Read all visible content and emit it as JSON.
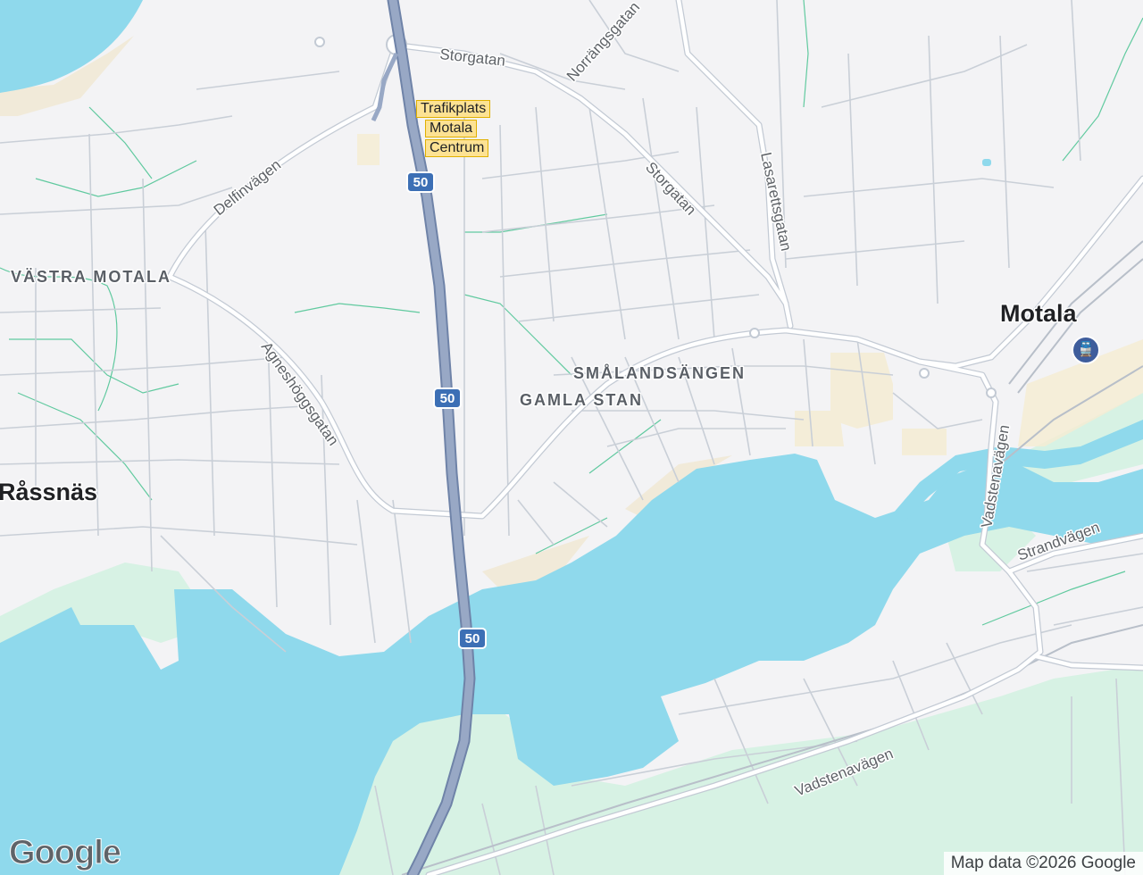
{
  "map": {
    "junction_label_lines": [
      "Trafikplats",
      "Motala",
      "Centrum"
    ],
    "route_shields": [
      "50",
      "50",
      "50"
    ],
    "streets": {
      "storgatan_1": "Storgatan",
      "storgatan_2": "Storgatan",
      "norrangsgatan": "Norrängsgatan",
      "lasarettsgatan": "Lasarettsgatan",
      "delfinvagen": "Delfinvägen",
      "agneshoggsgatan": "Agneshöggsgatan",
      "vadstenavagen_1": "Vadstenavägen",
      "vadstenavagen_2": "Vadstenavägen",
      "strandvagen": "Strandvägen"
    },
    "districts": {
      "vastra_motala": "VÄSTRA MOTALA",
      "smalandsangen": "SMÅLANDSÄNGEN",
      "gamla_stan": "GAMLA STAN"
    },
    "places": {
      "motala": "Motala",
      "rassnas": "Råssnäs"
    },
    "colors": {
      "water": "#8fd9ec",
      "land": "#f3f3f5",
      "park": "#d7f2e4",
      "road": "#ffffff",
      "minor_road": "#c9cfd7",
      "highway": "#8e9fbc",
      "path": "#3cbf8a",
      "junction_label_bg": "#fde293"
    }
  },
  "branding": {
    "logo": "Google",
    "attribution": "Map data ©2026 Google"
  }
}
